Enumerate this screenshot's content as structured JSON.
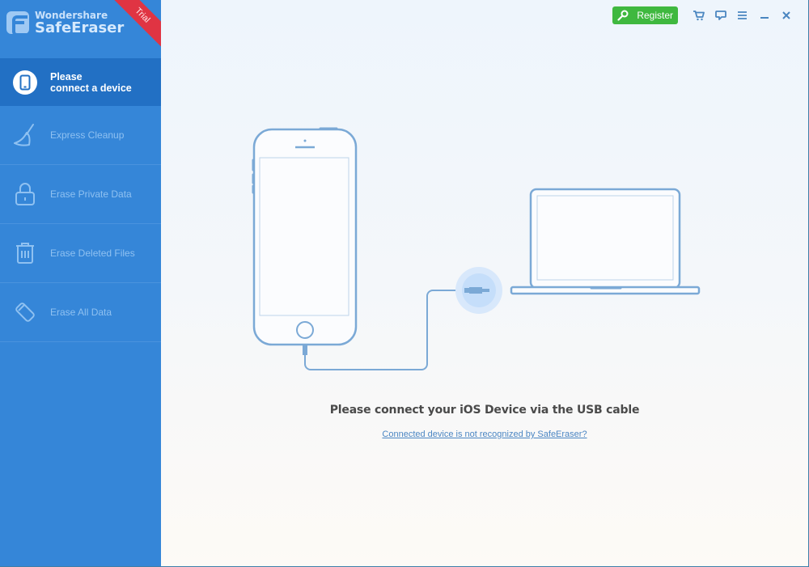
{
  "app": {
    "brand": "Wondershare",
    "product": "SafeEraser",
    "trial_badge": "Trial"
  },
  "topbar": {
    "register_label": "Register",
    "icons": [
      "key-icon",
      "cart-icon",
      "feedback-icon",
      "menu-icon",
      "minimize-icon",
      "close-icon"
    ]
  },
  "sidebar": {
    "items": [
      {
        "label_line1": "Please",
        "label_line2": "connect a device",
        "icon": "phone-icon",
        "active": true
      },
      {
        "label": "Express Cleanup",
        "icon": "broom-icon",
        "active": false
      },
      {
        "label": "Erase Private Data",
        "icon": "lock-icon",
        "active": false
      },
      {
        "label": "Erase Deleted Files",
        "icon": "trash-icon",
        "active": false
      },
      {
        "label": "Erase All Data",
        "icon": "eraser-icon",
        "active": false
      }
    ]
  },
  "main": {
    "message": "Please connect your iOS Device via the USB cable",
    "help_link": "Connected device is not recognized by SafeEraser?"
  },
  "colors": {
    "sidebar": "#3586d8",
    "sidebar_active": "#2270c4",
    "register": "#3fb83f",
    "trial": "#e03443",
    "line_art": "#7ba9d6"
  }
}
